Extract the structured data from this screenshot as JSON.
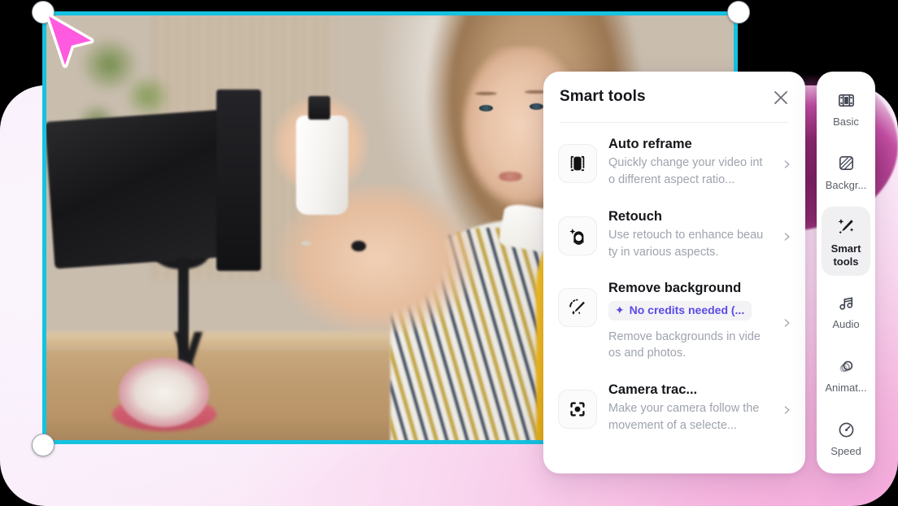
{
  "canvas": {
    "name": "video-preview",
    "selection_border_color": "#15c2e0",
    "cursor_color": "#ff5ae0",
    "handles": [
      "top-left",
      "top-right",
      "bottom-left"
    ]
  },
  "panel": {
    "title": "Smart tools",
    "close_icon": "close-icon",
    "tools": [
      {
        "icon": "auto-reframe-icon",
        "name": "Auto reframe",
        "desc": "Quickly change your video into different aspect ratio...",
        "badge": null,
        "chevron": "chevron-right-icon"
      },
      {
        "icon": "retouch-icon",
        "name": "Retouch",
        "desc": "Use retouch to enhance beauty in various aspects.",
        "badge": null,
        "chevron": "chevron-right-icon"
      },
      {
        "icon": "magic-wand-icon",
        "name": "Remove background",
        "desc": "Remove backgrounds in videos and photos.",
        "badge": "No credits needed (...",
        "badge_color": "#5b4ae6",
        "chevron": "chevron-right-icon"
      },
      {
        "icon": "camera-tracking-icon",
        "name": "Camera trac...",
        "desc": "Make your camera follow the movement of a selecte...",
        "badge": null,
        "chevron": "chevron-right-icon"
      }
    ]
  },
  "rail": {
    "items": [
      {
        "icon": "film-strip-icon",
        "label": "Basic",
        "active": false
      },
      {
        "icon": "background-icon",
        "label": "Backgr...",
        "active": false
      },
      {
        "icon": "magic-wand-icon",
        "label": "Smart\ntools",
        "active": true
      },
      {
        "icon": "music-note-icon",
        "label": "Audio",
        "active": false
      },
      {
        "icon": "animation-icon",
        "label": "Animat...",
        "active": false
      },
      {
        "icon": "speedometer-icon",
        "label": "Speed",
        "active": false
      }
    ]
  }
}
